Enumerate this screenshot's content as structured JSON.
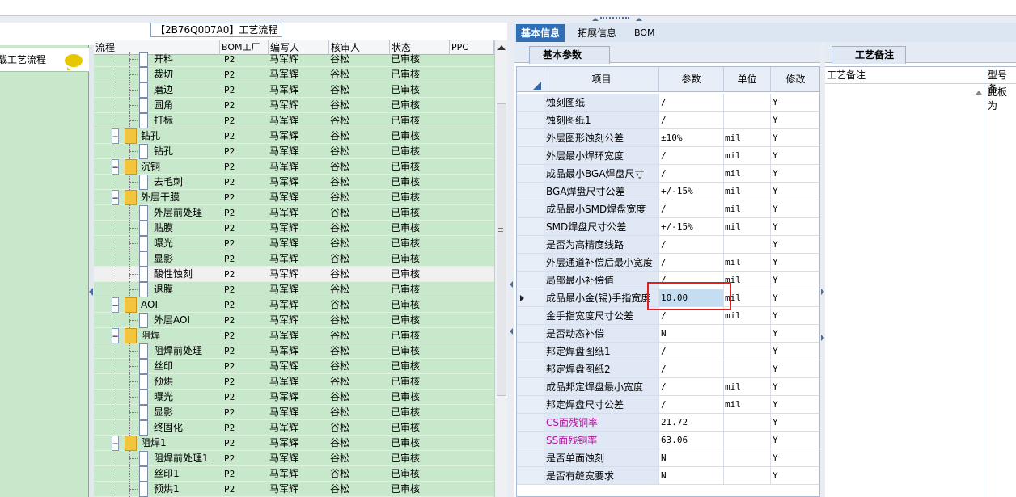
{
  "left_panel": {
    "item_label": "载工艺流程"
  },
  "flow": {
    "title": "【2B76Q007A0】工艺流程",
    "columns": [
      "流程",
      "BOM工厂",
      "编写人",
      "核审人",
      "状态",
      "PPC"
    ],
    "rows": [
      {
        "name": "开料",
        "type": "leaf",
        "bom": "P2",
        "writer": "马军辉",
        "reviewer": "谷松",
        "status": "已审核"
      },
      {
        "name": "裁切",
        "type": "leaf",
        "bom": "P2",
        "writer": "马军辉",
        "reviewer": "谷松",
        "status": "已审核"
      },
      {
        "name": "磨边",
        "type": "leaf",
        "bom": "P2",
        "writer": "马军辉",
        "reviewer": "谷松",
        "status": "已审核"
      },
      {
        "name": "圆角",
        "type": "leaf",
        "bom": "P2",
        "writer": "马军辉",
        "reviewer": "谷松",
        "status": "已审核"
      },
      {
        "name": "打标",
        "type": "leaf",
        "bom": "P2",
        "writer": "马军辉",
        "reviewer": "谷松",
        "status": "已审核"
      },
      {
        "name": "钻孔",
        "type": "folder",
        "bom": "P2",
        "writer": "马军辉",
        "reviewer": "谷松",
        "status": "已审核"
      },
      {
        "name": "钻孔",
        "type": "leaf",
        "bom": "P2",
        "writer": "马军辉",
        "reviewer": "谷松",
        "status": "已审核"
      },
      {
        "name": "沉铜",
        "type": "folder",
        "bom": "P2",
        "writer": "马军辉",
        "reviewer": "谷松",
        "status": "已审核"
      },
      {
        "name": "去毛刺",
        "type": "leaf",
        "bom": "P2",
        "writer": "马军辉",
        "reviewer": "谷松",
        "status": "已审核"
      },
      {
        "name": "外层干膜",
        "type": "folder",
        "bom": "P2",
        "writer": "马军辉",
        "reviewer": "谷松",
        "status": "已审核"
      },
      {
        "name": "外层前处理",
        "type": "leaf",
        "bom": "P2",
        "writer": "马军辉",
        "reviewer": "谷松",
        "status": "已审核"
      },
      {
        "name": "贴膜",
        "type": "leaf",
        "bom": "P2",
        "writer": "马军辉",
        "reviewer": "谷松",
        "status": "已审核"
      },
      {
        "name": "曝光",
        "type": "leaf",
        "bom": "P2",
        "writer": "马军辉",
        "reviewer": "谷松",
        "status": "已审核"
      },
      {
        "name": "显影",
        "type": "leaf",
        "bom": "P2",
        "writer": "马军辉",
        "reviewer": "谷松",
        "status": "已审核"
      },
      {
        "name": "酸性蚀刻",
        "type": "leaf",
        "bom": "P2",
        "writer": "马军辉",
        "reviewer": "谷松",
        "status": "已审核",
        "selected": true
      },
      {
        "name": "退膜",
        "type": "leaf",
        "bom": "P2",
        "writer": "马军辉",
        "reviewer": "谷松",
        "status": "已审核"
      },
      {
        "name": "AOI",
        "type": "folder",
        "bom": "P2",
        "writer": "马军辉",
        "reviewer": "谷松",
        "status": "已审核"
      },
      {
        "name": "外层AOI",
        "type": "leaf",
        "bom": "P2",
        "writer": "马军辉",
        "reviewer": "谷松",
        "status": "已审核"
      },
      {
        "name": "阻焊",
        "type": "folder",
        "bom": "P2",
        "writer": "马军辉",
        "reviewer": "谷松",
        "status": "已审核"
      },
      {
        "name": "阻焊前处理",
        "type": "leaf",
        "bom": "P2",
        "writer": "马军辉",
        "reviewer": "谷松",
        "status": "已审核"
      },
      {
        "name": "丝印",
        "type": "leaf",
        "bom": "P2",
        "writer": "马军辉",
        "reviewer": "谷松",
        "status": "已审核"
      },
      {
        "name": "预烘",
        "type": "leaf",
        "bom": "P2",
        "writer": "马军辉",
        "reviewer": "谷松",
        "status": "已审核"
      },
      {
        "name": "曝光",
        "type": "leaf",
        "bom": "P2",
        "writer": "马军辉",
        "reviewer": "谷松",
        "status": "已审核"
      },
      {
        "name": "显影",
        "type": "leaf",
        "bom": "P2",
        "writer": "马军辉",
        "reviewer": "谷松",
        "status": "已审核"
      },
      {
        "name": "终固化",
        "type": "leaf",
        "bom": "P2",
        "writer": "马军辉",
        "reviewer": "谷松",
        "status": "已审核"
      },
      {
        "name": "阻焊1",
        "type": "folder",
        "bom": "P2",
        "writer": "马军辉",
        "reviewer": "谷松",
        "status": "已审核"
      },
      {
        "name": "阻焊前处理1",
        "type": "leaf",
        "bom": "P2",
        "writer": "马军辉",
        "reviewer": "谷松",
        "status": "已审核"
      },
      {
        "name": "丝印1",
        "type": "leaf",
        "bom": "P2",
        "writer": "马军辉",
        "reviewer": "谷松",
        "status": "已审核"
      },
      {
        "name": "预烘1",
        "type": "leaf",
        "bom": "P2",
        "writer": "马军辉",
        "reviewer": "谷松",
        "status": "已审核"
      }
    ]
  },
  "tabs": [
    "基本信息",
    "拓展信息",
    "BOM"
  ],
  "active_tab": "基本信息",
  "params": {
    "subtab": "基本参数",
    "columns": [
      "项目",
      "参数",
      "单位",
      "修改"
    ],
    "rows": [
      {
        "item": "蚀刻图纸",
        "value": "/",
        "unit": "",
        "mod": "Y"
      },
      {
        "item": "蚀刻图纸1",
        "value": "/",
        "unit": "",
        "mod": "Y"
      },
      {
        "item": "外层图形蚀刻公差",
        "value": "±10%",
        "unit": "mil",
        "mod": "Y"
      },
      {
        "item": "外层最小焊环宽度",
        "value": "/",
        "unit": "mil",
        "mod": "Y"
      },
      {
        "item": "成品最小BGA焊盘尺寸",
        "value": "/",
        "unit": "mil",
        "mod": "Y"
      },
      {
        "item": "BGA焊盘尺寸公差",
        "value": "+/-15%",
        "unit": "mil",
        "mod": "Y"
      },
      {
        "item": "成品最小SMD焊盘宽度",
        "value": "/",
        "unit": "mil",
        "mod": "Y"
      },
      {
        "item": "SMD焊盘尺寸公差",
        "value": "+/-15%",
        "unit": "mil",
        "mod": "Y"
      },
      {
        "item": "是否为高精度线路",
        "value": "/",
        "unit": "",
        "mod": "Y"
      },
      {
        "item": "外层通道补偿后最小宽度",
        "value": "/",
        "unit": "mil",
        "mod": "Y"
      },
      {
        "item": "局部最小补偿值",
        "value": "/",
        "unit": "mil",
        "mod": "Y"
      },
      {
        "item": "成品最小金(锡)手指宽度",
        "value": "10.00",
        "unit": "mil",
        "mod": "Y",
        "current": true
      },
      {
        "item": "金手指宽度尺寸公差",
        "value": "/",
        "unit": "mil",
        "mod": "Y"
      },
      {
        "item": "是否动态补偿",
        "value": "N",
        "unit": "",
        "mod": "Y"
      },
      {
        "item": "邦定焊盘图纸1",
        "value": "/",
        "unit": "",
        "mod": "Y"
      },
      {
        "item": "邦定焊盘图纸2",
        "value": "/",
        "unit": "",
        "mod": "Y"
      },
      {
        "item": "成品邦定焊盘最小宽度",
        "value": "/",
        "unit": "mil",
        "mod": "Y"
      },
      {
        "item": "邦定焊盘尺寸公差",
        "value": "/",
        "unit": "mil",
        "mod": "Y"
      },
      {
        "item": "CS面残铜率",
        "value": "21.72",
        "unit": "",
        "mod": "Y",
        "magenta": true
      },
      {
        "item": "SS面残铜率",
        "value": "63.06",
        "unit": "",
        "mod": "Y",
        "magenta": true
      },
      {
        "item": "是否单面蚀刻",
        "value": "N",
        "unit": "",
        "mod": "Y"
      },
      {
        "item": "是否有缝宽要求",
        "value": "N",
        "unit": "",
        "mod": "Y"
      }
    ]
  },
  "notes": {
    "tab": "工艺备注",
    "col1": "工艺备注",
    "col2": "型号备",
    "cell": "此板为"
  }
}
